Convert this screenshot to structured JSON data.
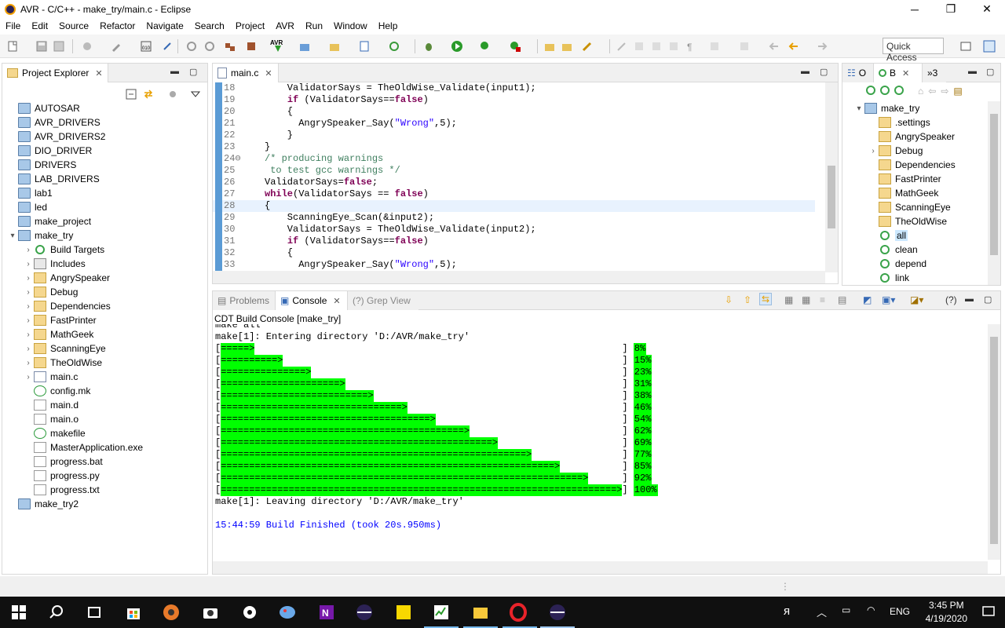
{
  "window": {
    "title": "AVR - C/C++ - make_try/main.c - Eclipse"
  },
  "menu": [
    "File",
    "Edit",
    "Source",
    "Refactor",
    "Navigate",
    "Search",
    "Project",
    "AVR",
    "Run",
    "Window",
    "Help"
  ],
  "toolbar": {
    "quick_access": "Quick Access"
  },
  "explorer": {
    "tab_label": "Project Explorer",
    "items": [
      {
        "label": "AUTOSAR",
        "icon": "project-icon",
        "indent": 0,
        "twisty": ""
      },
      {
        "label": "AVR_DRIVERS",
        "icon": "project-icon",
        "indent": 0,
        "twisty": ""
      },
      {
        "label": "AVR_DRIVERS2",
        "icon": "project-icon",
        "indent": 0,
        "twisty": ""
      },
      {
        "label": "DIO_DRIVER",
        "icon": "project-icon",
        "indent": 0,
        "twisty": ""
      },
      {
        "label": "DRIVERS",
        "icon": "project-icon",
        "indent": 0,
        "twisty": ""
      },
      {
        "label": "LAB_DRIVERS",
        "icon": "project-icon",
        "indent": 0,
        "twisty": ""
      },
      {
        "label": "lab1",
        "icon": "project-icon",
        "indent": 0,
        "twisty": ""
      },
      {
        "label": "led",
        "icon": "project-icon",
        "indent": 0,
        "twisty": ""
      },
      {
        "label": "make_project",
        "icon": "project-icon",
        "indent": 0,
        "twisty": ""
      },
      {
        "label": "make_try",
        "icon": "open-project-icon",
        "indent": 0,
        "twisty": "▾"
      },
      {
        "label": "Build Targets",
        "icon": "build-target-icon",
        "indent": 1,
        "twisty": "›"
      },
      {
        "label": "Includes",
        "icon": "includes-icon",
        "indent": 1,
        "twisty": "›"
      },
      {
        "label": "AngrySpeaker",
        "icon": "folder-icon",
        "indent": 1,
        "twisty": "›"
      },
      {
        "label": "Debug",
        "icon": "folder-icon",
        "indent": 1,
        "twisty": "›"
      },
      {
        "label": "Dependencies",
        "icon": "folder-icon",
        "indent": 1,
        "twisty": "›"
      },
      {
        "label": "FastPrinter",
        "icon": "folder-icon",
        "indent": 1,
        "twisty": "›"
      },
      {
        "label": "MathGeek",
        "icon": "folder-icon",
        "indent": 1,
        "twisty": "›"
      },
      {
        "label": "ScanningEye",
        "icon": "folder-icon",
        "indent": 1,
        "twisty": "›"
      },
      {
        "label": "TheOldWise",
        "icon": "folder-icon",
        "indent": 1,
        "twisty": "›"
      },
      {
        "label": "main.c",
        "icon": "c-file-icon",
        "indent": 1,
        "twisty": "›"
      },
      {
        "label": "config.mk",
        "icon": "makefile-icon",
        "indent": 1,
        "twisty": ""
      },
      {
        "label": "main.d",
        "icon": "file-icon",
        "indent": 1,
        "twisty": ""
      },
      {
        "label": "main.o",
        "icon": "binary-file-icon",
        "indent": 1,
        "twisty": ""
      },
      {
        "label": "makefile",
        "icon": "makefile-icon",
        "indent": 1,
        "twisty": ""
      },
      {
        "label": "MasterApplication.exe",
        "icon": "binary-file-icon",
        "indent": 1,
        "twisty": ""
      },
      {
        "label": "progress.bat",
        "icon": "file-icon",
        "indent": 1,
        "twisty": ""
      },
      {
        "label": "progress.py",
        "icon": "file-icon",
        "indent": 1,
        "twisty": ""
      },
      {
        "label": "progress.txt",
        "icon": "file-icon",
        "indent": 1,
        "twisty": ""
      },
      {
        "label": "make_try2",
        "icon": "project-icon",
        "indent": 0,
        "twisty": ""
      }
    ]
  },
  "editor": {
    "tab_label": "main.c",
    "lines": [
      {
        "n": "18",
        "segs": [
          {
            "t": "    ValidatorSays = TheOldWise_Validate(input1);",
            "c": ""
          }
        ]
      },
      {
        "n": "19",
        "segs": [
          {
            "t": "    ",
            "c": ""
          },
          {
            "t": "if",
            "c": "kw"
          },
          {
            "t": " (ValidatorSays==",
            "c": ""
          },
          {
            "t": "false",
            "c": "kw"
          },
          {
            "t": ")",
            "c": ""
          }
        ]
      },
      {
        "n": "20",
        "segs": [
          {
            "t": "    {",
            "c": ""
          }
        ]
      },
      {
        "n": "21",
        "segs": [
          {
            "t": "      AngrySpeaker_Say(",
            "c": ""
          },
          {
            "t": "\"Wrong\"",
            "c": "str"
          },
          {
            "t": ",5);",
            "c": ""
          }
        ]
      },
      {
        "n": "22",
        "segs": [
          {
            "t": "    }",
            "c": ""
          }
        ]
      },
      {
        "n": "23",
        "segs": [
          {
            "t": "}",
            "c": ""
          }
        ]
      },
      {
        "n": "24⊖",
        "segs": [
          {
            "t": "/* producing warnings",
            "c": "cmt"
          }
        ]
      },
      {
        "n": "25",
        "segs": [
          {
            "t": " to test gcc warnings */",
            "c": "cmt"
          }
        ]
      },
      {
        "n": "26",
        "segs": [
          {
            "t": "ValidatorSays=",
            "c": ""
          },
          {
            "t": "false",
            "c": "kw"
          },
          {
            "t": ";",
            "c": ""
          }
        ]
      },
      {
        "n": "27",
        "segs": [
          {
            "t": "while",
            "c": "kw"
          },
          {
            "t": "(ValidatorSays == ",
            "c": ""
          },
          {
            "t": "false",
            "c": "kw"
          },
          {
            "t": ")",
            "c": ""
          }
        ]
      },
      {
        "n": "28",
        "segs": [
          {
            "t": "{",
            "c": ""
          }
        ],
        "current": true
      },
      {
        "n": "29",
        "segs": [
          {
            "t": "    ScanningEye_Scan(&input2);",
            "c": ""
          }
        ]
      },
      {
        "n": "30",
        "segs": [
          {
            "t": "    ValidatorSays = TheOldWise_Validate(input2);",
            "c": ""
          }
        ]
      },
      {
        "n": "31",
        "segs": [
          {
            "t": "    ",
            "c": ""
          },
          {
            "t": "if",
            "c": "kw"
          },
          {
            "t": " (ValidatorSays==",
            "c": ""
          },
          {
            "t": "false",
            "c": "kw"
          },
          {
            "t": ")",
            "c": ""
          }
        ]
      },
      {
        "n": "32",
        "segs": [
          {
            "t": "    {",
            "c": ""
          }
        ]
      },
      {
        "n": "33",
        "segs": [
          {
            "t": "      AngrySpeaker_Say(",
            "c": ""
          },
          {
            "t": "\"Wrong\"",
            "c": "str"
          },
          {
            "t": ",5);",
            "c": ""
          }
        ]
      }
    ]
  },
  "outline": {
    "tabs": [
      "O",
      "B",
      "»3"
    ],
    "items": [
      {
        "label": "make_try",
        "icon": "open-project-icon",
        "indent": 0,
        "twisty": "▾"
      },
      {
        "label": ".settings",
        "icon": "folder-icon",
        "indent": 1,
        "twisty": ""
      },
      {
        "label": "AngrySpeaker",
        "icon": "folder-icon",
        "indent": 1,
        "twisty": ""
      },
      {
        "label": "Debug",
        "icon": "folder-icon",
        "indent": 1,
        "twisty": "›"
      },
      {
        "label": "Dependencies",
        "icon": "folder-icon",
        "indent": 1,
        "twisty": ""
      },
      {
        "label": "FastPrinter",
        "icon": "folder-icon",
        "indent": 1,
        "twisty": ""
      },
      {
        "label": "MathGeek",
        "icon": "folder-icon",
        "indent": 1,
        "twisty": ""
      },
      {
        "label": "ScanningEye",
        "icon": "folder-icon",
        "indent": 1,
        "twisty": ""
      },
      {
        "label": "TheOldWise",
        "icon": "folder-icon",
        "indent": 1,
        "twisty": ""
      },
      {
        "label": "all",
        "icon": "build-target-icon",
        "indent": 1,
        "twisty": "",
        "selected": true
      },
      {
        "label": "clean",
        "icon": "build-target-icon",
        "indent": 1,
        "twisty": ""
      },
      {
        "label": "depend",
        "icon": "build-target-icon",
        "indent": 1,
        "twisty": ""
      },
      {
        "label": "link",
        "icon": "build-target-icon",
        "indent": 1,
        "twisty": ""
      }
    ]
  },
  "console": {
    "tabs": {
      "problems": "Problems",
      "console": "Console",
      "grep": "(?) Grep View"
    },
    "build_label": "CDT Build Console [make_try]",
    "line_make_all": "make all",
    "line_enter": "make[1]: Entering directory 'D:/AVR/make_try'",
    "progress": [
      {
        "pct": "8%",
        "frac": 0.08
      },
      {
        "pct": "15%",
        "frac": 0.15
      },
      {
        "pct": "23%",
        "frac": 0.23
      },
      {
        "pct": "31%",
        "frac": 0.31
      },
      {
        "pct": "38%",
        "frac": 0.38
      },
      {
        "pct": "46%",
        "frac": 0.46
      },
      {
        "pct": "54%",
        "frac": 0.54
      },
      {
        "pct": "62%",
        "frac": 0.62
      },
      {
        "pct": "69%",
        "frac": 0.69
      },
      {
        "pct": "77%",
        "frac": 0.77
      },
      {
        "pct": "85%",
        "frac": 0.85
      },
      {
        "pct": "92%",
        "frac": 0.92
      },
      {
        "pct": "100%",
        "frac": 1.0
      }
    ],
    "line_leave": "make[1]: Leaving directory 'D:/AVR/make_try'",
    "line_finished": "15:44:59 Build Finished (took 20s.950ms)"
  },
  "taskbar": {
    "time": "3:45 PM",
    "date": "4/19/2020",
    "lang": "ENG"
  },
  "colors": {
    "progress_fill": "#00ff00",
    "keyword": "#7f0055",
    "string": "#2a00ff",
    "comment": "#3f7f5f",
    "finish": "#0000ff"
  }
}
